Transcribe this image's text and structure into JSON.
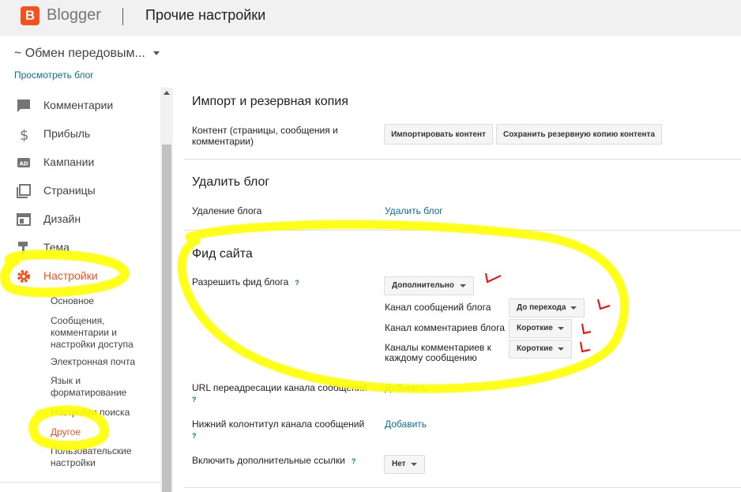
{
  "header": {
    "logo_letter": "B",
    "brand": "Blogger",
    "title": "Прочие настройки"
  },
  "blog": {
    "name": "~ Обмен передовым...",
    "view_link": "Просмотреть блог"
  },
  "sidebar": {
    "items": [
      {
        "label": "Комментарии"
      },
      {
        "label": "Прибыль"
      },
      {
        "label": "Кампании"
      },
      {
        "label": "Страницы"
      },
      {
        "label": "Дизайн"
      },
      {
        "label": "Тема"
      },
      {
        "label": "Настройки"
      }
    ],
    "subitems": [
      {
        "label": "Основное"
      },
      {
        "label": "Сообщения, комментарии и настройки доступа"
      },
      {
        "label": "Электронная почта"
      },
      {
        "label": "Язык и форматирование"
      },
      {
        "label": "Настройки поиска"
      },
      {
        "label": "Другое"
      },
      {
        "label": "Пользовательские настройки"
      }
    ],
    "accent": "#f4511e"
  },
  "import": {
    "title": "Импорт и резервная копия",
    "content_label": "Контент (страницы, сообщения и комментарии)",
    "import_button": "Импортировать контент",
    "backup_button": "Сохранить резервную копию контента"
  },
  "delete": {
    "title": "Удалить блог",
    "label": "Удаление блога",
    "link": "Удалить блог"
  },
  "feed": {
    "title": "Фид сайта",
    "allow_label": "Разрешить фид блога",
    "help": "?",
    "allow_value": "Дополнительно",
    "posts_label": "Канал сообщений блога",
    "posts_value": "До перехода",
    "comments_label": "Канал комментариев блога",
    "comments_value": "Короткие",
    "per_post_label": "Каналы комментариев к каждому сообщению",
    "per_post_value": "Короткие",
    "redirect_label": "URL переадресации канала сообщений",
    "redirect_link": "Добавить",
    "footer_label": "Нижний колонтитул канала сообщений",
    "footer_link": "Добавить",
    "extra_links_label": "Включить дополнительные ссылки",
    "extra_links_value": "Нет"
  },
  "colors": {
    "link": "#0b6e99",
    "highlight": "#ffff00",
    "mark": "#ff0000"
  }
}
